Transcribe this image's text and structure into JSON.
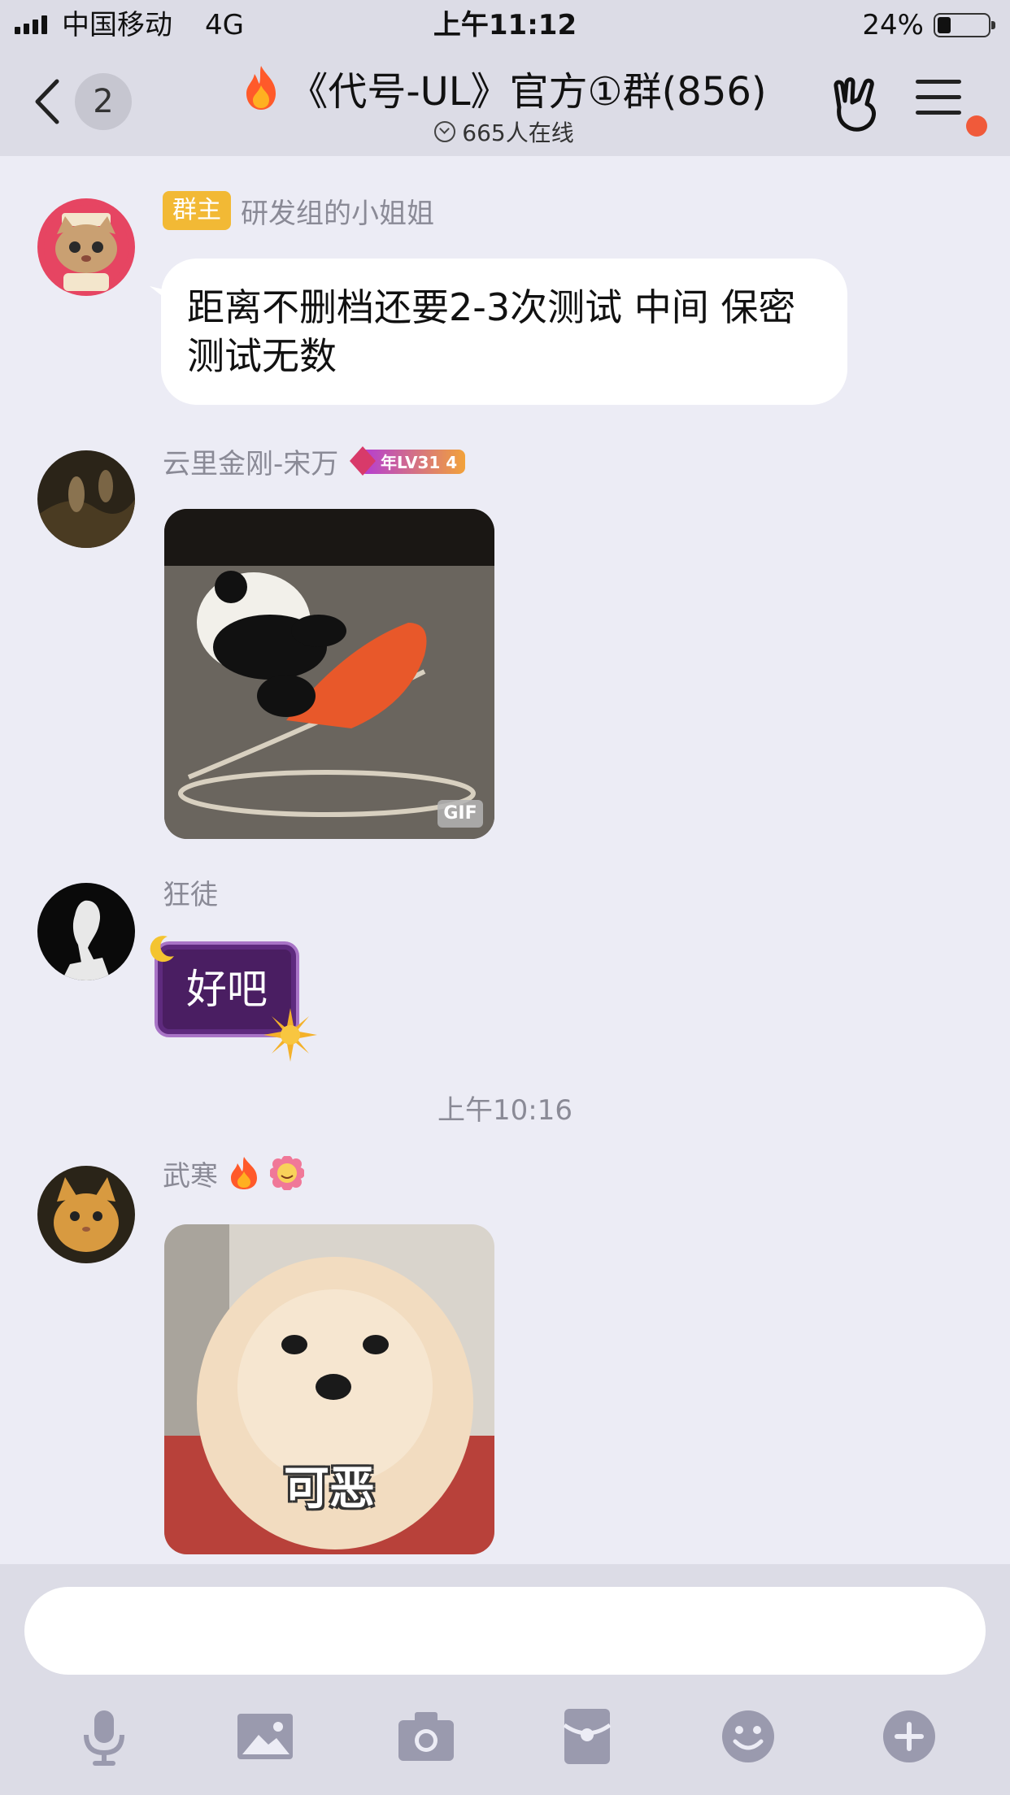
{
  "status_bar": {
    "carrier": "中国移动",
    "network": "4G",
    "time": "上午11:12",
    "battery_percent": "24%",
    "battery_level": 0.24
  },
  "header": {
    "back_count": "2",
    "title": "《代号-UL》官方①群(856)",
    "online": "665人在线",
    "menu_has_notification": true
  },
  "messages": [
    {
      "sender": "研发组的小姐姐",
      "role_badge": "群主",
      "type": "text",
      "text": "距离不删档还要2-3次测试 中间 保密测试无数"
    },
    {
      "sender": "云里金刚-宋万",
      "level_badge": "年LV31 4",
      "type": "gif",
      "gif_tag": "GIF"
    },
    {
      "sender": "狂徒",
      "type": "text-fancy",
      "text": "好吧"
    },
    {
      "type": "timestamp",
      "text": "上午10:16"
    },
    {
      "sender": "武寒",
      "type": "image",
      "caption": "可恶"
    }
  ],
  "input": {
    "placeholder": ""
  },
  "toolbar": [
    "microphone-icon",
    "image-icon",
    "camera-icon",
    "red-packet-icon",
    "emoji-icon",
    "plus-icon"
  ],
  "colors": {
    "background": "#ececf5",
    "bars": "#dcdce6",
    "owner_badge": "#f2b935",
    "notification_dot": "#f05a3a",
    "toolbar_icon": "#9a9aae",
    "name_text": "#8a8a96"
  }
}
